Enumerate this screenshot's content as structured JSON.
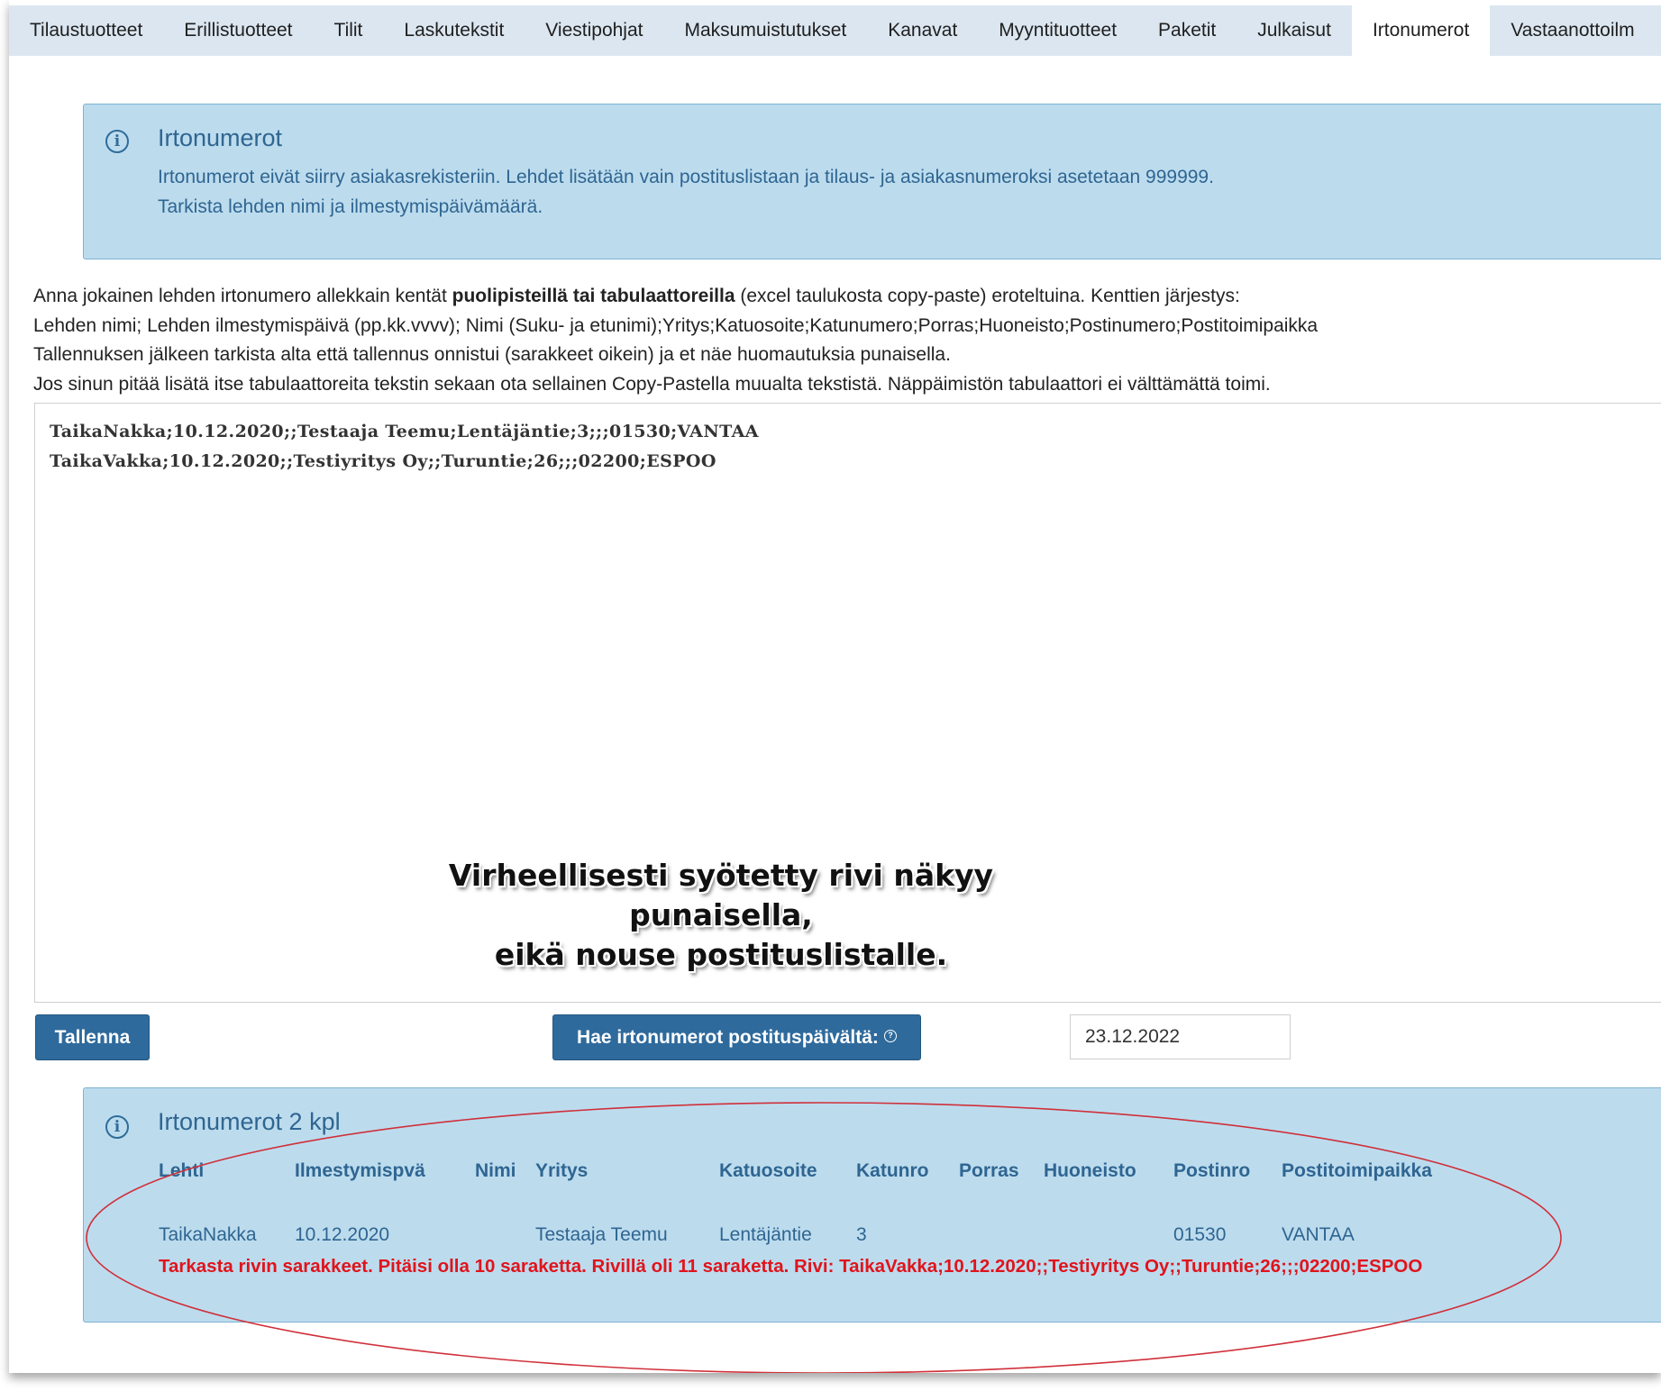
{
  "tabs": [
    {
      "label": "Tilaustuotteet"
    },
    {
      "label": "Erillistuotteet"
    },
    {
      "label": "Tilit"
    },
    {
      "label": "Laskutekstit"
    },
    {
      "label": "Viestipohjat"
    },
    {
      "label": "Maksumuistutukset"
    },
    {
      "label": "Kanavat"
    },
    {
      "label": "Myyntituotteet"
    },
    {
      "label": "Paketit"
    },
    {
      "label": "Julkaisut"
    },
    {
      "label": "Irtonumerot",
      "active": true
    },
    {
      "label": "Vastaanottoilm"
    }
  ],
  "info": {
    "title": "Irtonumerot",
    "line1": "Irtonumerot eivät siirry asiakasrekisteriin. Lehdet lisätään vain postituslistaan ja tilaus- ja asiakasnumeroksi asetetaan 999999.",
    "line2": "Tarkista lehden nimi ja ilmestymispäivämäärä."
  },
  "instructions": {
    "l1_pre": "Anna jokainen lehden irtonumero allekkain kentät ",
    "l1_bold": "puolipisteillä tai tabulaattoreilla",
    "l1_post": " (excel taulukosta copy-paste) eroteltuina. Kenttien järjestys:",
    "l2": "Lehden nimi; Lehden ilmestymispäivä (pp.kk.vvvv); Nimi (Suku- ja etunimi);Yritys;Katuosoite;Katunumero;Porras;Huoneisto;Postinumero;Postitoimipaikka",
    "l3": "Tallennuksen jälkeen tarkista alta että tallennus onnistui (sarakkeet oikein) ja et näe huomautuksia punaisella.",
    "l4": "Jos sinun pitää lisätä itse tabulaattoreita tekstin sekaan ota sellainen Copy-Pastella muualta tekstistä. Näppäimistön tabulaattori ei välttämättä toimi."
  },
  "textarea_value": "TaikaNakka;10.12.2020;;Testaaja Teemu;Lentäjäntie;3;;;01530;VANTAA\nTaikaVakka;10.12.2020;;Testiyritys Oy;;Turuntie;26;;;02200;ESPOO",
  "buttons": {
    "save": "Tallenna",
    "fetch": "Hae irtonumerot postituspäivältä:",
    "fetch_help_icon": "question-circle-icon"
  },
  "date_value": "23.12.2022",
  "annotation": {
    "line1": "Virheellisesti syötetty rivi näkyy punaisella,",
    "line2": "eikä nouse postituslistalle."
  },
  "result": {
    "title": "Irtonumerot 2 kpl",
    "headers": [
      "Lehti",
      "Ilmestymispvä",
      "Nimi",
      "Yritys",
      "Katuosoite",
      "Katunro",
      "Porras",
      "Huoneisto",
      "Postinro",
      "Postitoimipaikka"
    ],
    "rows": [
      [
        "TaikaNakka",
        "10.12.2020",
        "",
        "Testaaja Teemu",
        "Lentäjäntie",
        "3",
        "",
        "",
        "01530",
        "VANTAA"
      ]
    ],
    "error": "Tarkasta rivin sarakkeet. Pitäisi olla 10 saraketta. Rivillä oli 11 saraketta. Rivi: TaikaVakka;10.12.2020;;Testiyritys Oy;;Turuntie;26;;;02200;ESPOO"
  },
  "colors": {
    "info_bg": "#bcdcee",
    "info_text": "#2f6591",
    "button_bg": "#2f6a9c",
    "error_text": "#e0141c",
    "ellipse_stroke": "#d0303a"
  }
}
